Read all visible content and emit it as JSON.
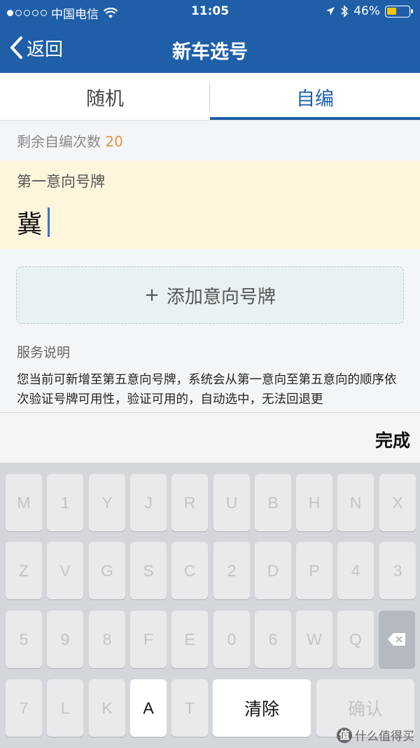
{
  "status_bar": {
    "carrier": "中国电信",
    "time": "11:05",
    "battery_text": "46%",
    "battery_level": 0.46
  },
  "nav": {
    "back_label": "返回",
    "title": "新车选号"
  },
  "tabs": [
    {
      "label": "随机",
      "active": false
    },
    {
      "label": "自编",
      "active": true
    }
  ],
  "remaining": {
    "label": "剩余自编次数",
    "count": "20"
  },
  "plate": {
    "label": "第一意向号牌",
    "value": "冀"
  },
  "add_plate": {
    "icon": "+",
    "label": "添加意向号牌"
  },
  "service": {
    "title": "服务说明",
    "text": "您当前可新增至第五意向号牌，系统会从第一意向至第五意向的顺序依次验证号牌可用性，验证可用的，自动选中，无法回退更"
  },
  "toolbar": {
    "done_label": "完成"
  },
  "keyboard": {
    "rows": [
      [
        "M",
        "1",
        "Y",
        "J",
        "R",
        "U",
        "B",
        "H",
        "N",
        "X"
      ],
      [
        "Z",
        "V",
        "G",
        "S",
        "C",
        "2",
        "D",
        "P",
        "4",
        "3"
      ],
      [
        "5",
        "9",
        "8",
        "F",
        "E",
        "0",
        "6",
        "W",
        "Q"
      ],
      [
        "7",
        "L",
        "K",
        "A",
        "T"
      ]
    ],
    "active_key": "A",
    "clear_label": "清除",
    "confirm_label": "确认"
  },
  "watermark": {
    "badge": "值",
    "text": "什么值得买"
  },
  "colors": {
    "brand_blue": "#1f5fa8",
    "count_orange": "#e8913a",
    "plate_bg": "#fdf5dc"
  }
}
